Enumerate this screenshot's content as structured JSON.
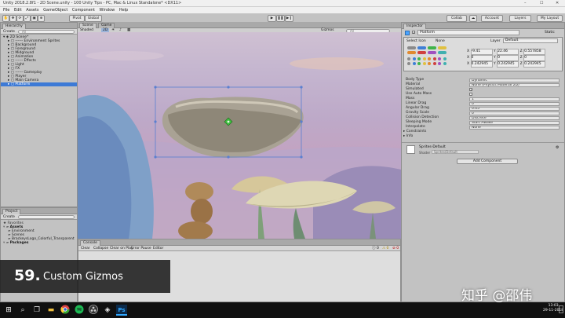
{
  "window": {
    "title": "Unity 2018.2.8f1 - 2D Scene.unity - 100 Unity Tips - PC, Mac & Linux Standalone* <DX11>"
  },
  "menu": [
    "File",
    "Edit",
    "Assets",
    "GameObject",
    "Component",
    "Window",
    "Help"
  ],
  "toolbar": {
    "pivot": "Pivot",
    "global": "Global",
    "collab": "Collab",
    "account": "Account",
    "layers": "Layers",
    "layout": "My Layout"
  },
  "hierarchy": {
    "tab": "Hierarchy",
    "create": "Create",
    "search_placeholder": "All",
    "items": [
      {
        "label": "2D Scene*",
        "depth": 0,
        "selected": false
      },
      {
        "label": "------ Environment Sprites",
        "depth": 1,
        "selected": false
      },
      {
        "label": "Background",
        "depth": 1,
        "selected": false
      },
      {
        "label": "Foreground",
        "depth": 1,
        "selected": false
      },
      {
        "label": "Midground",
        "depth": 1,
        "selected": false
      },
      {
        "label": "Animation",
        "depth": 1,
        "selected": false
      },
      {
        "label": "------ Effects",
        "depth": 1,
        "selected": false
      },
      {
        "label": "Light",
        "depth": 1,
        "selected": false
      },
      {
        "label": "FX",
        "depth": 1,
        "selected": false
      },
      {
        "label": "------ Gameplay",
        "depth": 1,
        "selected": false
      },
      {
        "label": "Player",
        "depth": 1,
        "selected": false
      },
      {
        "label": "Main Camera",
        "depth": 1,
        "selected": false
      },
      {
        "label": "Platform",
        "depth": 1,
        "selected": true
      }
    ]
  },
  "project": {
    "tab": "Project",
    "create": "Create",
    "favorites": "Favorites",
    "items": [
      {
        "label": "Assets",
        "depth": 0
      },
      {
        "label": "Environment",
        "depth": 1
      },
      {
        "label": "Scenes",
        "depth": 1
      },
      {
        "label": "BrackeysLogo_Colorful_Transparent",
        "depth": 1
      },
      {
        "label": "Packages",
        "depth": 0
      }
    ]
  },
  "scene": {
    "tabs": [
      "Scene",
      "Game"
    ],
    "shaded": "Shaded",
    "mode_2d": "2D",
    "gizmos": "Gizmos",
    "all": "All"
  },
  "console": {
    "tab": "Console",
    "buttons": [
      "Clear",
      "Collapse",
      "Clear on Play",
      "Error Pause",
      "Editor"
    ],
    "counts": [
      "0",
      "0",
      "0"
    ]
  },
  "inspector": {
    "tab": "Inspector",
    "object_name": "Platform",
    "static_label": "Static",
    "select_icon_label": "Select Icon",
    "none_label": "None",
    "layer_label": "Layer",
    "layer_value": "Default",
    "position": {
      "x": "-9.41",
      "y": "22.46",
      "z": "0.557858"
    },
    "rotation": {
      "x": "0",
      "y": "0",
      "z": "0"
    },
    "scale": {
      "x": "0.242945",
      "y": "0.242945",
      "z": "0.242945"
    },
    "props": [
      {
        "label": "Body Type",
        "value": "Dynamic",
        "kind": "select"
      },
      {
        "label": "Material",
        "value": "None (Physics Material 2D)",
        "kind": "field"
      },
      {
        "label": "Simulated",
        "value": "✓",
        "kind": "check"
      },
      {
        "label": "Use Auto Mass",
        "value": "",
        "kind": "check"
      },
      {
        "label": "Mass",
        "value": "1",
        "kind": "field"
      },
      {
        "label": "Linear Drag",
        "value": "0",
        "kind": "field"
      },
      {
        "label": "Angular Drag",
        "value": "0.05",
        "kind": "field"
      },
      {
        "label": "Gravity Scale",
        "value": "0",
        "kind": "field"
      },
      {
        "label": "Collision Detection",
        "value": "Discrete",
        "kind": "select"
      },
      {
        "label": "Sleeping Mode",
        "value": "Start Awake",
        "kind": "select"
      },
      {
        "label": "Interpolate",
        "value": "None",
        "kind": "select"
      }
    ],
    "constraints": "Constraints",
    "info": "Info",
    "material_name": "Sprites-Default",
    "shader_label": "Shader",
    "shader_value": "Sprites/Default",
    "add_component": "Add Component"
  },
  "caption": {
    "number": "59.",
    "title": "Custom Gizmos"
  },
  "watermark": "知乎 @邵伟",
  "taskbar": {
    "time": "13:03",
    "date": "29-11-2018"
  },
  "colors": {
    "selection": "#3d7ad6",
    "gizmo_green": "#3fbf3f",
    "rect_handle": "#5a7fd0"
  },
  "icons": [
    "windows-start-icon",
    "search-icon",
    "task-view-icon",
    "explorer-icon",
    "chrome-icon",
    "spotify-icon",
    "obs-icon",
    "unity-icon",
    "photoshop-icon"
  ]
}
